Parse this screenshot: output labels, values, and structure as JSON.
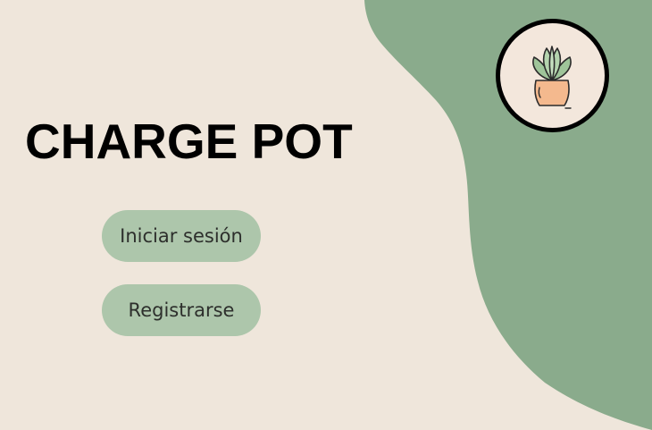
{
  "app": {
    "title": "CHARGE POT"
  },
  "actions": {
    "login_label": "Iniciar sesión",
    "register_label": "Registrarse"
  },
  "logo": {
    "icon": "potted-plant-icon"
  },
  "colors": {
    "background": "#efe6db",
    "accent_green": "#8aab8c",
    "button_green": "#adc6ab",
    "pot": "#f4b98e"
  }
}
